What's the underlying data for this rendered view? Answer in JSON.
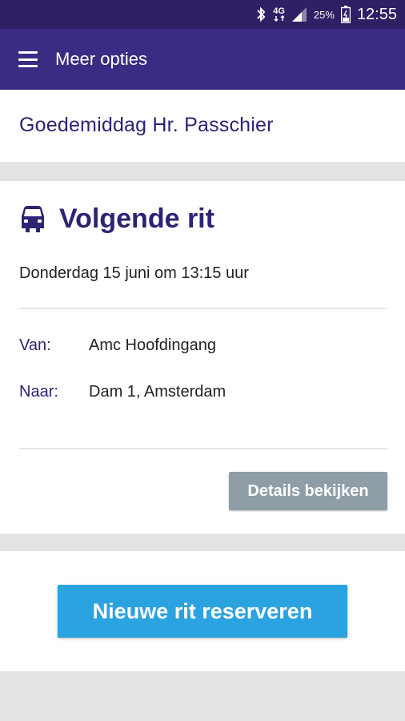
{
  "status_bar": {
    "icons": [
      "bluetooth-icon",
      "network-4g-icon",
      "signal-icon",
      "battery-icon"
    ],
    "network": "4G",
    "battery_percent": "25%",
    "time": "12:55"
  },
  "app_bar": {
    "menu_icon": "hamburger-menu-icon",
    "title": "Meer opties"
  },
  "greeting": "Goedemiddag Hr. Passchier",
  "next_ride": {
    "icon": "car-icon",
    "title": "Volgende rit",
    "datetime": "Donderdag 15 juni om 13:15 uur",
    "from_label": "Van:",
    "from_value": "Amc Hoofdingang",
    "to_label": "Naar:",
    "to_value": "Dam 1, Amsterdam",
    "details_button": "Details bekijken"
  },
  "new_ride_button": "Nieuwe rit reserveren",
  "colors": {
    "status_bar": "#2f1f64",
    "app_bar": "#3b2b82",
    "primary_text": "#2b2474",
    "details_button": "#8f9ea6",
    "new_ride_button": "#2ba3e0",
    "background": "#e3e3e3"
  }
}
